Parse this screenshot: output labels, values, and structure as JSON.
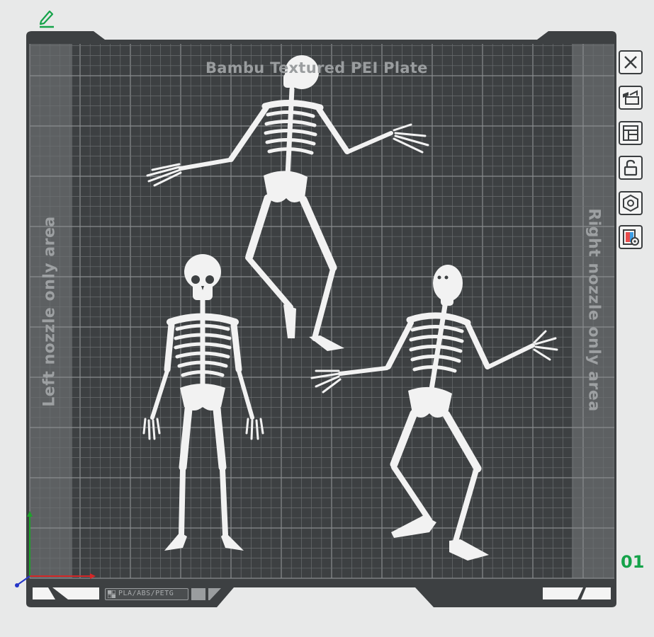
{
  "plate": {
    "title": "Bambu Textured PEI Plate",
    "left_zone_label": "Left nozzle only area",
    "right_zone_label": "Right nozzle only area",
    "plate_number": "01",
    "filament_types": "PLA/ABS/PETG"
  },
  "toolbar": [
    {
      "name": "close-plate-button",
      "icon": "close-icon"
    },
    {
      "name": "auto-arrange-button",
      "icon": "arrange-icon"
    },
    {
      "name": "plate-layout-button",
      "icon": "layout-icon"
    },
    {
      "name": "lock-plate-button",
      "icon": "lock-open-icon"
    },
    {
      "name": "plate-settings-button",
      "icon": "hex-settings-icon"
    },
    {
      "name": "plate-preview-button",
      "icon": "preview-icon"
    }
  ],
  "objects": [
    {
      "name": "skeleton-standing"
    },
    {
      "name": "skeleton-dancing-top"
    },
    {
      "name": "skeleton-dancing-right"
    }
  ],
  "colors": {
    "plate": "#3d4042",
    "side_zone": "#5c5f61",
    "grid_line": "#6b6e70",
    "grid_major": "#8a8d8f",
    "accent": "#15a34a",
    "model": "#f2f2f2"
  }
}
